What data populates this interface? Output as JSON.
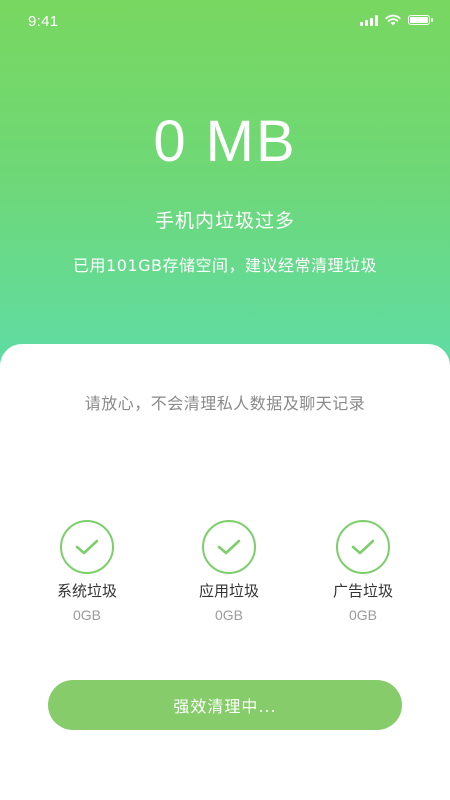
{
  "status_bar": {
    "time": "9:41"
  },
  "hero": {
    "size_readout": "0 MB",
    "title": "手机内垃圾过多",
    "subtitle": "已用101GB存储空间，建议经常清理垃圾"
  },
  "card": {
    "reassurance": "请放心，不会清理私人数据及聊天记录",
    "items": [
      {
        "label": "系统垃圾",
        "value": "0GB",
        "icon": "check-icon"
      },
      {
        "label": "应用垃圾",
        "value": "0GB",
        "icon": "check-icon"
      },
      {
        "label": "广告垃圾",
        "value": "0GB",
        "icon": "check-icon"
      }
    ],
    "button_label": "强效清理中..."
  },
  "colors": {
    "gradient_top": "#78d760",
    "gradient_bottom": "#5edca8",
    "accent_green": "#7ccf6a",
    "button_bg": "#86cc6a"
  }
}
